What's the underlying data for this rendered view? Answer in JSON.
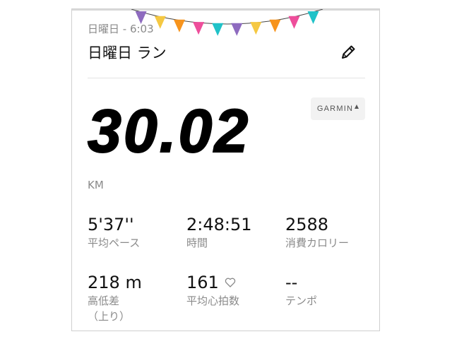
{
  "activity": {
    "subtitle": "日曜日 - 6:03",
    "title": "日曜日 ラン",
    "edit_icon": "pencil-icon",
    "source_badge": "GARMIN"
  },
  "distance": {
    "value": "30.02",
    "unit": "KM"
  },
  "stats": [
    {
      "value": "5'37''",
      "label": "平均ペース"
    },
    {
      "value": "2:48:51",
      "label": "時間"
    },
    {
      "value": "2588",
      "label": "消費カロリー"
    },
    {
      "value": "218 m",
      "label": "高低差\n（上り）"
    },
    {
      "value": "161",
      "label": "平均心拍数",
      "icon": "heart-icon"
    },
    {
      "value": "--",
      "label": "テンポ"
    }
  ],
  "decoration": {
    "bunting_colors": [
      "#8e6bbf",
      "#f5c842",
      "#f7941d",
      "#ee4e9b",
      "#20c2c8",
      "#8e6bbf",
      "#f5c842",
      "#f7941d",
      "#ee4e9b",
      "#20c2c8"
    ]
  }
}
